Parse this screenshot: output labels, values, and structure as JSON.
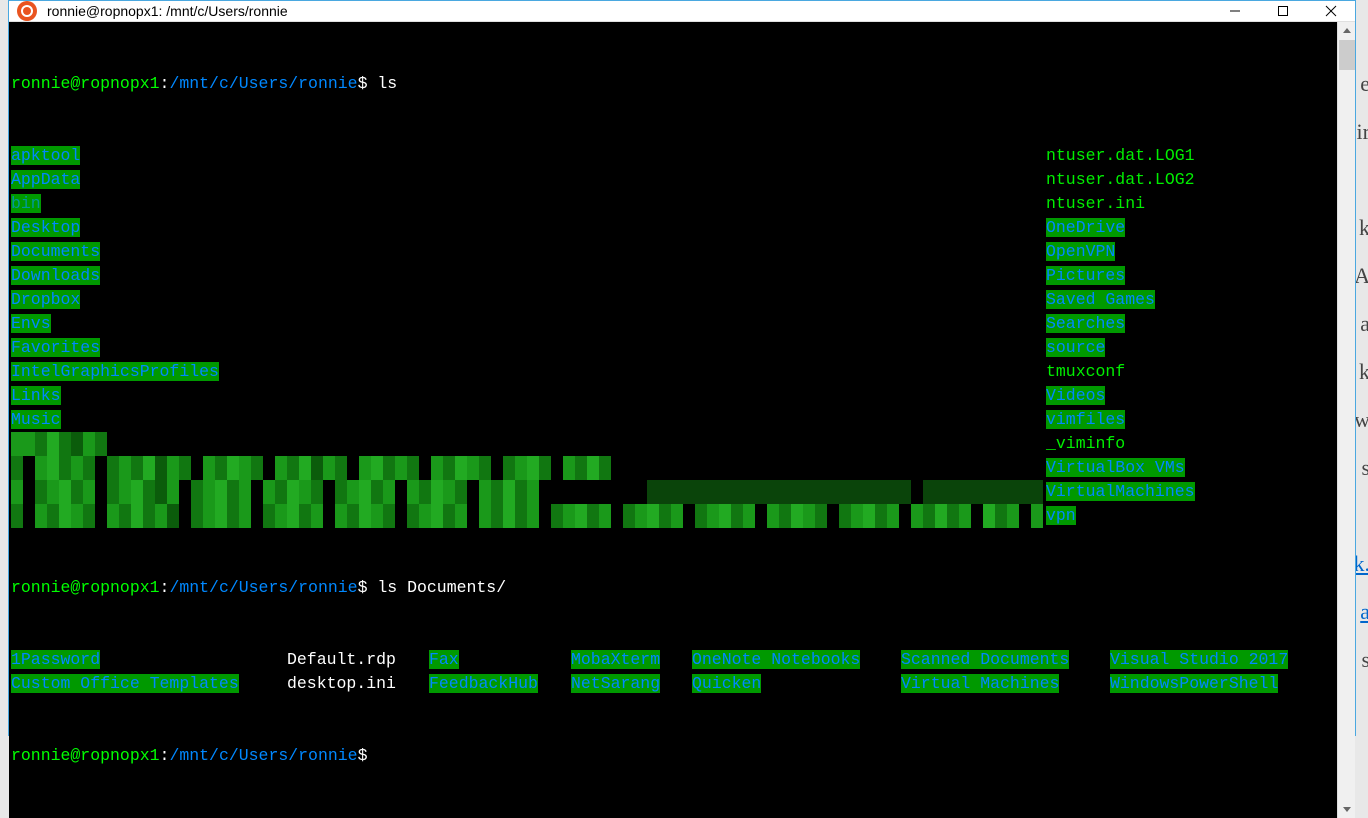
{
  "window": {
    "title": "ronnie@ropnopx1: /mnt/c/Users/ronnie"
  },
  "prompt": {
    "user_host": "ronnie@ropnopx1",
    "colon": ":",
    "path": "/mnt/c/Users/ronnie",
    "symbol": "$"
  },
  "commands": {
    "cmd1": "ls",
    "cmd2": "ls Documents/"
  },
  "ls_left": [
    {
      "name": "apktool",
      "type": "dir"
    },
    {
      "name": "AppData",
      "type": "dir"
    },
    {
      "name": "bin",
      "type": "dir-cyan"
    },
    {
      "name": "Desktop",
      "type": "dir"
    },
    {
      "name": "Documents",
      "type": "dir"
    },
    {
      "name": "Downloads",
      "type": "dir"
    },
    {
      "name": "Dropbox",
      "type": "dir"
    },
    {
      "name": "Envs",
      "type": "dir"
    },
    {
      "name": "Favorites",
      "type": "dir"
    },
    {
      "name": "IntelGraphicsProfiles",
      "type": "dir"
    },
    {
      "name": "Links",
      "type": "dir"
    },
    {
      "name": "Music",
      "type": "dir"
    }
  ],
  "ls_right": [
    {
      "name": "ntuser.dat.LOG1",
      "type": "file-green"
    },
    {
      "name": "ntuser.dat.LOG2",
      "type": "file-green"
    },
    {
      "name": "ntuser.ini",
      "type": "file-green"
    },
    {
      "name": "OneDrive",
      "type": "dir"
    },
    {
      "name": "OpenVPN",
      "type": "dir"
    },
    {
      "name": "Pictures",
      "type": "dir"
    },
    {
      "name": "Saved Games",
      "type": "dir"
    },
    {
      "name": "Searches",
      "type": "dir"
    },
    {
      "name": "source",
      "type": "dir"
    },
    {
      "name": "tmuxconf",
      "type": "file-green"
    },
    {
      "name": "Videos",
      "type": "dir"
    },
    {
      "name": "vimfiles",
      "type": "dir"
    },
    {
      "name": "_viminfo",
      "type": "file-green"
    },
    {
      "name": "VirtualBox VMs",
      "type": "dir"
    },
    {
      "name": "VirtualMachines",
      "type": "dir"
    },
    {
      "name": "vpn",
      "type": "dir"
    }
  ],
  "docs_cols": [
    [
      {
        "name": "1Password",
        "type": "dir"
      },
      {
        "name": "Custom Office Templates",
        "type": "dir"
      }
    ],
    [
      {
        "name": "Default.rdp",
        "type": "file-white"
      },
      {
        "name": "desktop.ini",
        "type": "file-white"
      }
    ],
    [
      {
        "name": "Fax",
        "type": "dir"
      },
      {
        "name": "FeedbackHub",
        "type": "dir"
      }
    ],
    [
      {
        "name": "MobaXterm",
        "type": "dir"
      },
      {
        "name": "NetSarang",
        "type": "dir"
      }
    ],
    [
      {
        "name": "OneNote Notebooks",
        "type": "dir"
      },
      {
        "name": "Quicken",
        "type": "dir"
      }
    ],
    [
      {
        "name": "Scanned Documents",
        "type": "dir"
      },
      {
        "name": "Virtual Machines",
        "type": "dir"
      }
    ],
    [
      {
        "name": "Visual Studio 2017",
        "type": "dir"
      },
      {
        "name": "WindowsPowerShell",
        "type": "dir"
      }
    ]
  ],
  "bg_partial": {
    "l1": "e",
    "l2": "ir",
    "l3": "k",
    "l4": "A",
    "l5": "a",
    "l6": "k",
    "l7": "w",
    "l8": "s",
    "l9": "k.",
    "l10": "a",
    "l11": "s"
  }
}
